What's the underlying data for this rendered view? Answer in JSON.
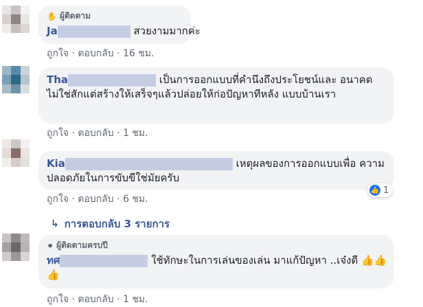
{
  "comments": [
    {
      "badge": "ผู้ติดตาม",
      "name": "Ja",
      "text": "สวยงามมากค่ะ",
      "actions": {
        "like": "ถูกใจ",
        "reply": "ตอบกลับ",
        "time": "16 ชม."
      }
    },
    {
      "name": "Tha",
      "text_first": "เป็นการออกแบบที่คำนึงถึงประโยชน์และ",
      "text_rest": "อนาคต ไม่ใช่สักแต่สร้างให้เสร็จๆแล้วปล่อยให้ก่อปัญหาทีหลัง แบบบ้านเรา",
      "actions": {
        "like": "ถูกใจ",
        "reply": "ตอบกลับ",
        "time": "1 ชม."
      }
    },
    {
      "name": "Kia",
      "text_first": "เหตุผลของการออกแบบเพื่อ",
      "text_rest": "ความปลอดภัยในการขับขีใช่มัยครับ",
      "reaction_count": "1",
      "actions": {
        "like": "ถูกใจ",
        "reply": "ตอบกลับ",
        "time": "6 ชม."
      }
    },
    {
      "badge": "ผู้ติดตามครบปี",
      "name": "ทศ",
      "text_first": "ใช้ทักษะในการเล่นของเล่น มาแก้ปัญหา",
      "text_rest": "..เจ๋งดี",
      "emoji": "👍👍👍",
      "actions": {
        "like": "ถูกใจ",
        "reply": "ตอบกลับ",
        "time": "1 ชม."
      }
    }
  ],
  "replies_link": "การตอบกลับ 3 รายการ",
  "separator": "·",
  "colors": {
    "link": "#385898",
    "bubble": "#f2f3f5",
    "like": "#1877f2",
    "meta": "#606770"
  }
}
